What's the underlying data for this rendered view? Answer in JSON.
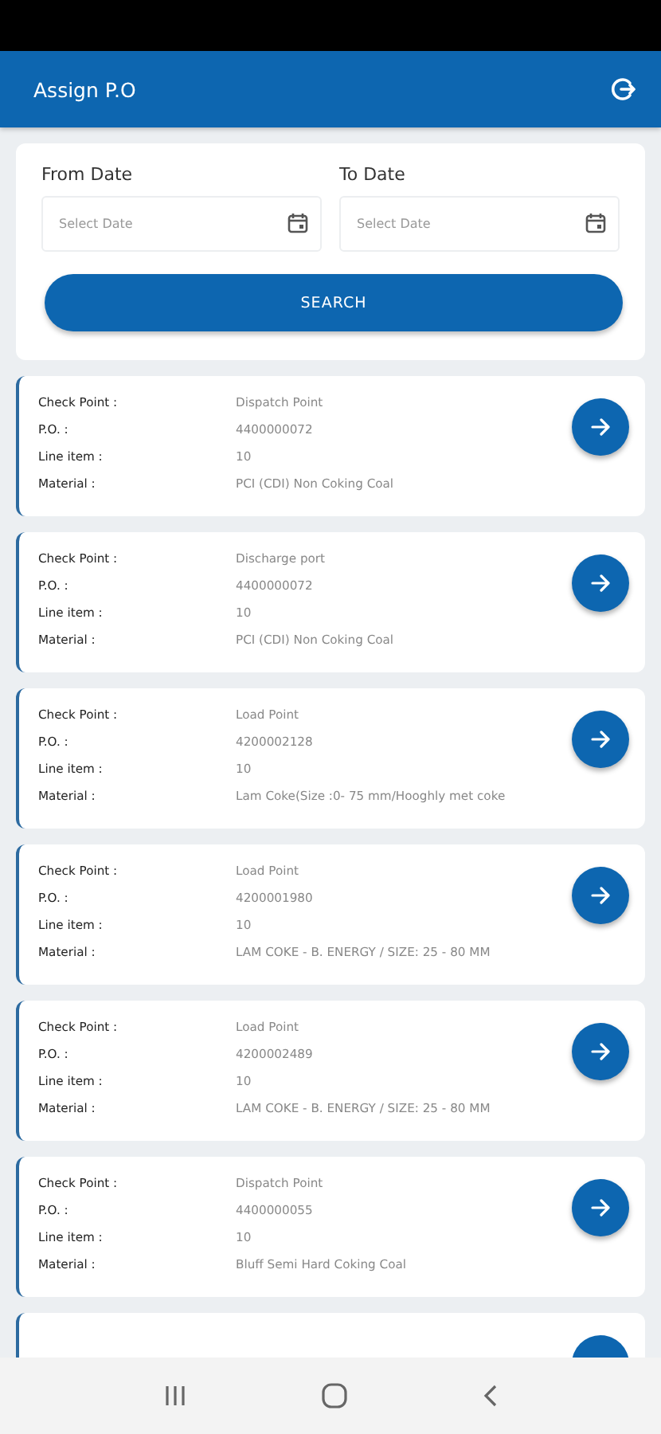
{
  "app_bar": {
    "title": "Assign P.O"
  },
  "filter": {
    "from_label": "From Date",
    "from_placeholder": "Select Date",
    "to_label": "To Date",
    "to_placeholder": "Select Date",
    "search_button": "SEARCH"
  },
  "orders": [
    {
      "fields": [
        {
          "label": "Check Point :",
          "value": "Dispatch Point"
        },
        {
          "label": "P.O. :",
          "value": "4400000072"
        },
        {
          "label": "Line item :",
          "value": "10"
        },
        {
          "label": "Material :",
          "value": "PCI (CDI) Non Coking Coal"
        }
      ]
    },
    {
      "fields": [
        {
          "label": "Check Point :",
          "value": "Discharge port"
        },
        {
          "label": "P.O. :",
          "value": "4400000072"
        },
        {
          "label": "Line item :",
          "value": "10"
        },
        {
          "label": "Material :",
          "value": "PCI (CDI) Non Coking Coal"
        }
      ]
    },
    {
      "fields": [
        {
          "label": "Check Point :",
          "value": "Load Point"
        },
        {
          "label": "P.O. :",
          "value": "4200002128"
        },
        {
          "label": "Line item :",
          "value": "10"
        },
        {
          "label": "Material :",
          "value": "Lam Coke(Size :0- 75 mm/Hooghly met coke"
        }
      ]
    },
    {
      "fields": [
        {
          "label": "Check Point :",
          "value": "Load Point"
        },
        {
          "label": "P.O. :",
          "value": "4200001980"
        },
        {
          "label": "Line item :",
          "value": "10"
        },
        {
          "label": "Material :",
          "value": "LAM COKE - B. ENERGY / SIZE: 25 - 80 MM"
        }
      ]
    },
    {
      "fields": [
        {
          "label": "Check Point :",
          "value": "Load Point"
        },
        {
          "label": "P.O. :",
          "value": "4200002489"
        },
        {
          "label": "Line item :",
          "value": "10"
        },
        {
          "label": "Material :",
          "value": "LAM COKE - B. ENERGY / SIZE: 25 - 80 MM"
        }
      ]
    },
    {
      "fields": [
        {
          "label": "Check Point :",
          "value": "Dispatch Point"
        },
        {
          "label": "P.O. :",
          "value": "4400000055"
        },
        {
          "label": "Line item :",
          "value": "10"
        },
        {
          "label": "Material :",
          "value": "Bluff Semi Hard Coking Coal"
        }
      ]
    }
  ],
  "list_continues": true
}
